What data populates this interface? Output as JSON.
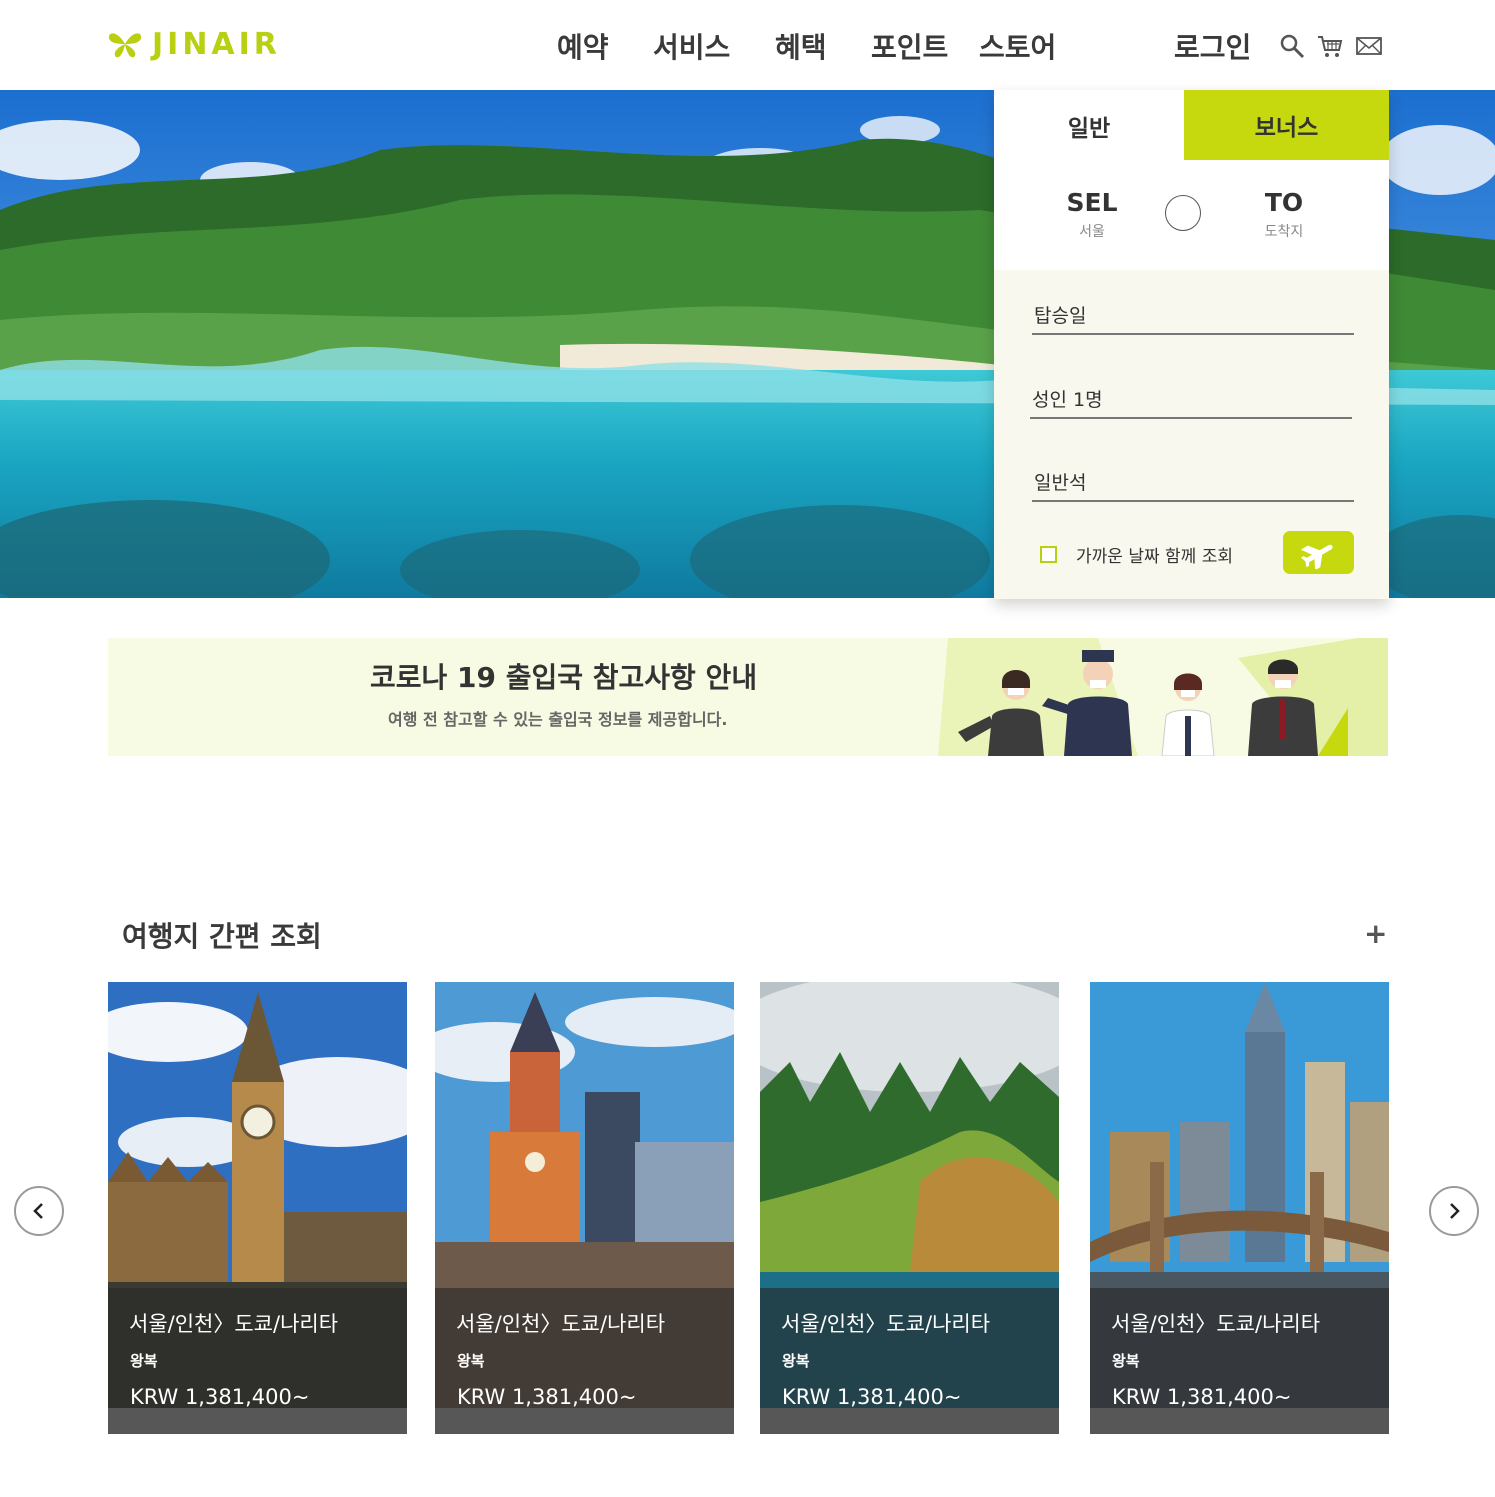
{
  "brand": {
    "name": "JINAIR",
    "accent": "#c6d90e"
  },
  "header": {
    "nav": [
      "예약",
      "서비스",
      "혜택",
      "포인트",
      "스토어"
    ],
    "login": "로그인",
    "icons": [
      "search-icon",
      "cart-icon",
      "mail-icon"
    ]
  },
  "booking": {
    "tabs": {
      "general": "일반",
      "bonus": "보너스"
    },
    "origin": {
      "code": "SEL",
      "city": "서울"
    },
    "destination": {
      "code": "TO",
      "city": "도착지"
    },
    "fields": {
      "date": "탑승일",
      "passengers": "성인 1명",
      "cabin": "일반석"
    },
    "nearby_dates": "가까운 날짜 함께 조회"
  },
  "banner": {
    "title": "코로나 19 출입국 참고사항 안내",
    "subtitle": "여행 전 참고할 수 있는 출입국 정보를 제공합니다."
  },
  "destinations": {
    "title": "여행지 간편 조회",
    "more": "+",
    "cards": [
      {
        "route": "서울/인천〉도쿄/나리타",
        "trip": "왕복",
        "price": "KRW 1,381,400~"
      },
      {
        "route": "서울/인천〉도쿄/나리타",
        "trip": "왕복",
        "price": "KRW 1,381,400~"
      },
      {
        "route": "서울/인천〉도쿄/나리타",
        "trip": "왕복",
        "price": "KRW 1,381,400~"
      },
      {
        "route": "서울/인천〉도쿄/나리타",
        "trip": "왕복",
        "price": "KRW 1,381,400~"
      }
    ]
  }
}
